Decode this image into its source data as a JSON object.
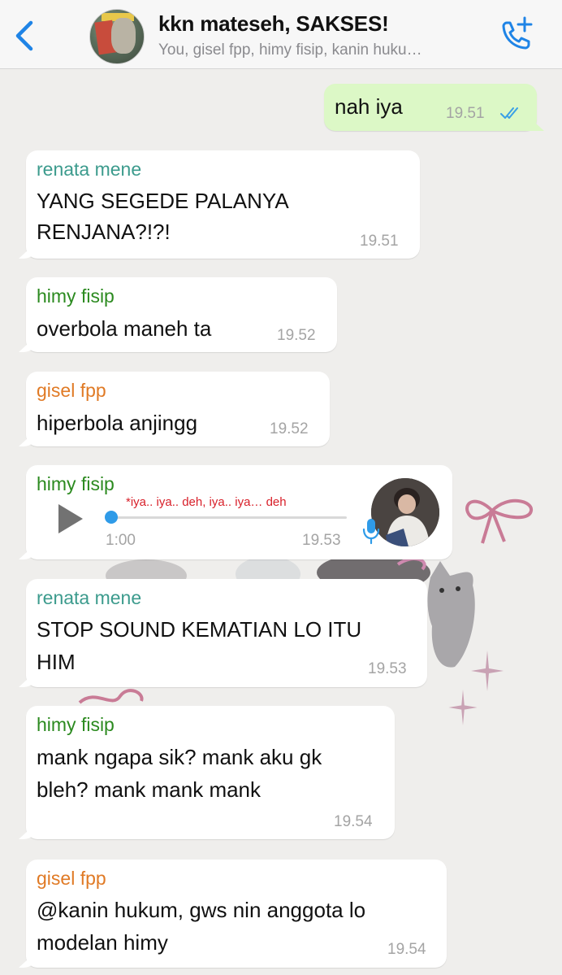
{
  "header": {
    "title": "kkn mateseh, SAKSES!",
    "subtitle": "You, gisel fpp, himy fisip, kanin huku…"
  },
  "colors": {
    "ios_blue": "#1f84e6",
    "outgoing_bubble": "#dcf8c6",
    "read_ticks": "#3aa0e6",
    "sender_teal": "#3c9b8d",
    "sender_green": "#2b8a1f",
    "sender_orange": "#e07a25",
    "lyric_red": "#d8202a"
  },
  "icons": {
    "back": "chevron-left-icon",
    "call": "phone-plus-icon",
    "ticks": "double-check-icon",
    "play": "play-icon",
    "mic": "microphone-icon"
  },
  "messages": [
    {
      "text": "nah iya",
      "time": "19.51"
    },
    {
      "sender": "renata mene",
      "line1": "YANG SEGEDE PALANYA",
      "line2": "RENJANA?!?!",
      "time": "19.51"
    },
    {
      "sender": "himy fisip",
      "text": "overbola maneh ta",
      "time": "19.52"
    },
    {
      "sender": "gisel fpp",
      "text": "hiperbola anjingg",
      "time": "19.52"
    },
    {
      "sender": "himy fisip",
      "duration": "1:00",
      "lyric": "*iya.. iya.. deh, iya.. iya… deh",
      "time": "19.53",
      "progress": 0
    },
    {
      "sender": "renata mene",
      "line1": "STOP SOUND KEMATIAN LO ITU",
      "line2": "HIM",
      "time": "19.53"
    },
    {
      "sender": "himy fisip",
      "line1": "mank ngapa sik? mank aku gk",
      "line2": "bleh? mank mank mank",
      "time": "19.54"
    },
    {
      "sender": "gisel fpp",
      "line1": "@kanin hukum, gws nin anggota lo",
      "line2": "modelan himy",
      "time": "19.54"
    }
  ]
}
